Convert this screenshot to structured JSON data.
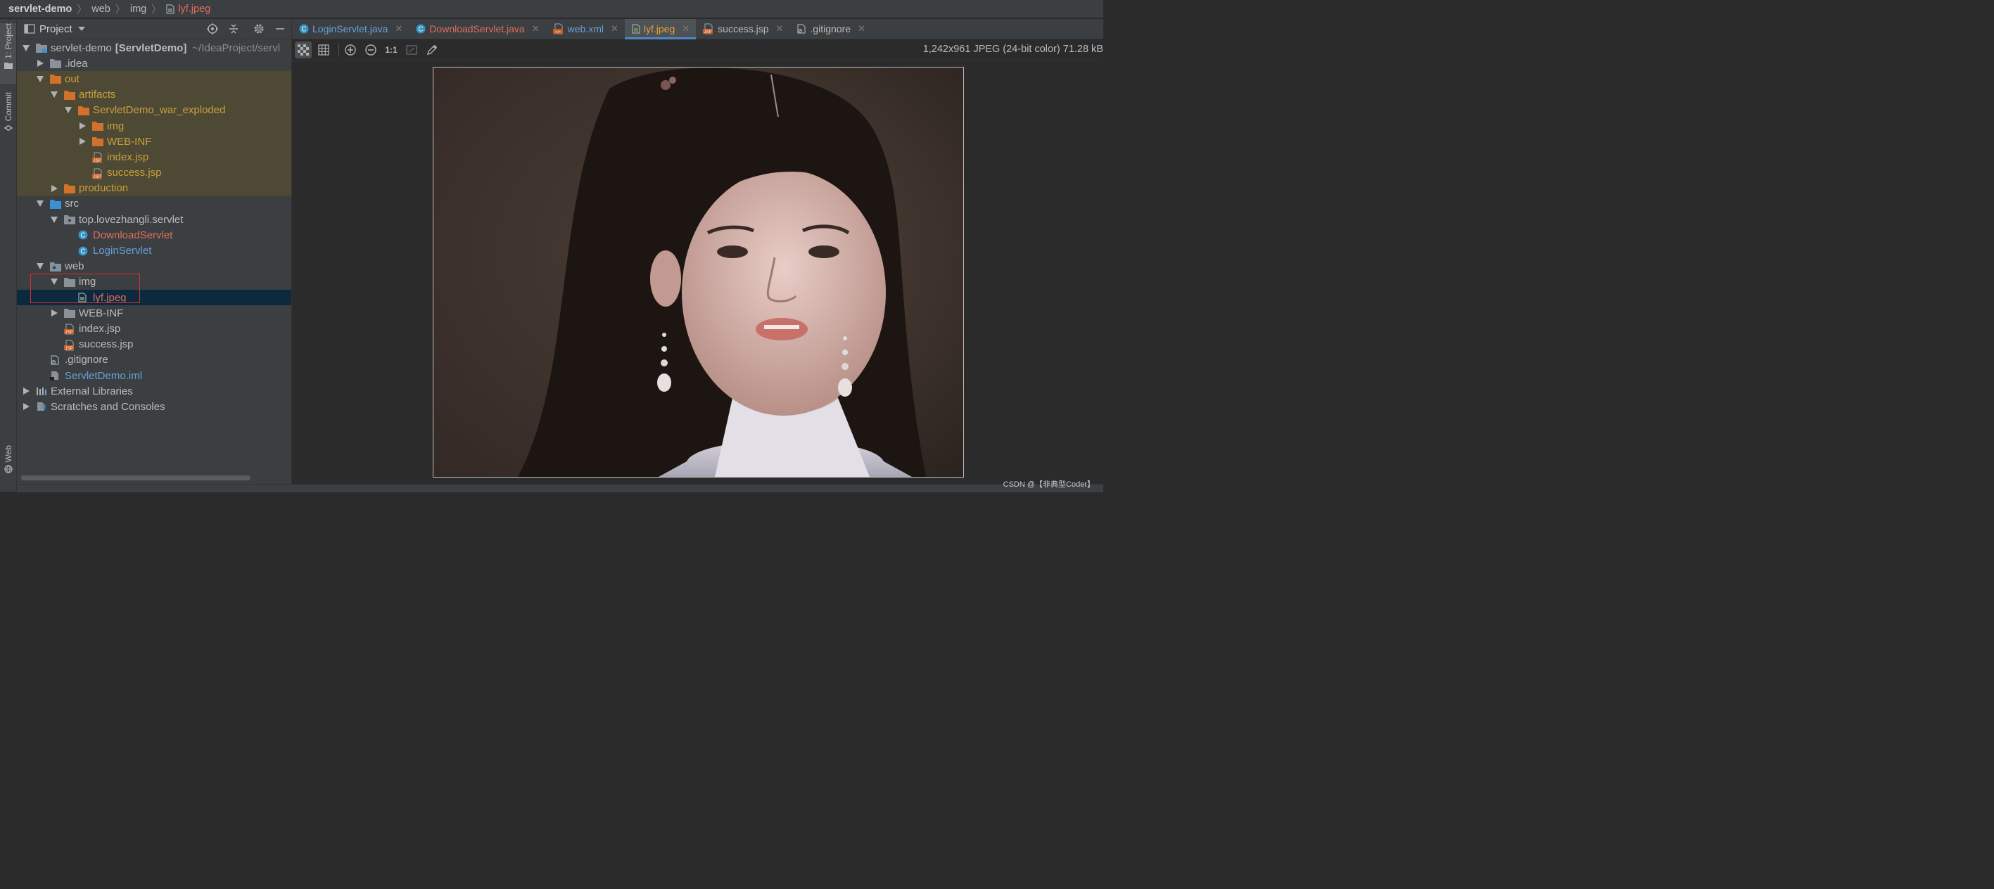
{
  "breadcrumb": [
    "servlet-demo",
    "web",
    "img",
    "lyf.jpeg"
  ],
  "left_strip": {
    "project": "1: Project",
    "commit": "Commit",
    "web": "Web"
  },
  "project_panel": {
    "title": "Project",
    "tree": [
      {
        "label": "servlet-demo",
        "extra": "[ServletDemo]",
        "path": "~/IdeaProject/servl",
        "arrow": "down",
        "icon": "module-icon",
        "color": "",
        "depth": 0,
        "bg": ""
      },
      {
        "label": ".idea",
        "arrow": "right",
        "icon": "folder-gray-icon",
        "color": "",
        "depth": 1,
        "bg": ""
      },
      {
        "label": "out",
        "arrow": "down",
        "icon": "folder-orange-icon",
        "color": "orange",
        "depth": 1,
        "bg": "excluded"
      },
      {
        "label": "artifacts",
        "arrow": "down",
        "icon": "folder-orange-icon",
        "color": "orange",
        "depth": 2,
        "bg": "excluded"
      },
      {
        "label": "ServletDemo_war_exploded",
        "arrow": "down",
        "icon": "folder-orange-icon",
        "color": "orange",
        "depth": 3,
        "bg": "excluded"
      },
      {
        "label": "img",
        "arrow": "right",
        "icon": "folder-orange-icon",
        "color": "orange",
        "depth": 4,
        "bg": "excluded"
      },
      {
        "label": "WEB-INF",
        "arrow": "right",
        "icon": "folder-orange-icon",
        "color": "orange",
        "depth": 4,
        "bg": "excluded"
      },
      {
        "label": "index.jsp",
        "arrow": "none",
        "icon": "jsp-file-icon",
        "color": "orange",
        "depth": 4,
        "bg": "excluded"
      },
      {
        "label": "success.jsp",
        "arrow": "none",
        "icon": "jsp-file-icon",
        "color": "orange",
        "depth": 4,
        "bg": "excluded"
      },
      {
        "label": "production",
        "arrow": "right",
        "icon": "folder-orange-icon",
        "color": "orange",
        "depth": 2,
        "bg": "excluded"
      },
      {
        "label": "src",
        "arrow": "down",
        "icon": "folder-blue-icon",
        "color": "",
        "depth": 1,
        "bg": ""
      },
      {
        "label": "top.lovezhangli.servlet",
        "arrow": "down",
        "icon": "package-icon",
        "color": "",
        "depth": 2,
        "bg": ""
      },
      {
        "label": "DownloadServlet",
        "arrow": "none",
        "icon": "java-class-icon",
        "color": "red",
        "depth": 3,
        "bg": ""
      },
      {
        "label": "LoginServlet",
        "arrow": "none",
        "icon": "java-class-icon",
        "color": "blue",
        "depth": 3,
        "bg": ""
      },
      {
        "label": "web",
        "arrow": "down",
        "icon": "web-folder-icon",
        "color": "",
        "depth": 1,
        "bg": ""
      },
      {
        "label": "img",
        "arrow": "down",
        "icon": "folder-gray-icon",
        "color": "",
        "depth": 2,
        "bg": ""
      },
      {
        "label": "lyf.jpeg",
        "arrow": "none",
        "icon": "image-file-icon",
        "color": "red",
        "depth": 3,
        "bg": "selected"
      },
      {
        "label": "WEB-INF",
        "arrow": "right",
        "icon": "folder-gray-icon",
        "color": "",
        "depth": 2,
        "bg": ""
      },
      {
        "label": "index.jsp",
        "arrow": "none",
        "icon": "jsp-file-icon",
        "color": "",
        "depth": 2,
        "bg": ""
      },
      {
        "label": "success.jsp",
        "arrow": "none",
        "icon": "jsp-file-icon",
        "color": "",
        "depth": 2,
        "bg": ""
      },
      {
        "label": ".gitignore",
        "arrow": "none",
        "icon": "gitignore-file-icon",
        "color": "",
        "depth": 1,
        "bg": ""
      },
      {
        "label": "ServletDemo.iml",
        "arrow": "none",
        "icon": "iml-file-icon",
        "color": "blue",
        "depth": 1,
        "bg": ""
      },
      {
        "label": "External Libraries",
        "arrow": "right",
        "icon": "libraries-icon",
        "color": "",
        "depth": 0,
        "bg": ""
      },
      {
        "label": "Scratches and Consoles",
        "arrow": "right",
        "icon": "scratches-icon",
        "color": "",
        "depth": 0,
        "bg": ""
      }
    ]
  },
  "editor_tabs": [
    {
      "label": "LoginServlet.java",
      "icon": "java-class-icon",
      "color": "blue",
      "active": false
    },
    {
      "label": "DownloadServlet.java",
      "icon": "java-class-icon",
      "color": "red",
      "active": false
    },
    {
      "label": "web.xml",
      "icon": "xml-file-icon",
      "color": "blue",
      "active": false
    },
    {
      "label": "lyf.jpeg",
      "icon": "image-file-icon",
      "color": "orange",
      "active": true
    },
    {
      "label": "success.jsp",
      "icon": "jsp-file-icon",
      "color": "",
      "active": false
    },
    {
      "label": ".gitignore",
      "icon": "gitignore-file-icon",
      "color": "",
      "active": false
    }
  ],
  "image_toolbar": {
    "actual_size_label": "1:1",
    "info": "1,242x961 JPEG (24-bit color) 71.28 kB"
  },
  "watermark": "CSDN @【非典型Coder】",
  "colors": {
    "bg": "#2b2b2b",
    "panel": "#3c3f41",
    "excluded_row": "#4e4935",
    "selected_row": "#0d293e",
    "accent": "#4a88c7",
    "orange_text": "#c8a13b",
    "red_text": "#e06c5c",
    "blue_text": "#6a9fd8",
    "annotation_box": "#d9302c"
  }
}
